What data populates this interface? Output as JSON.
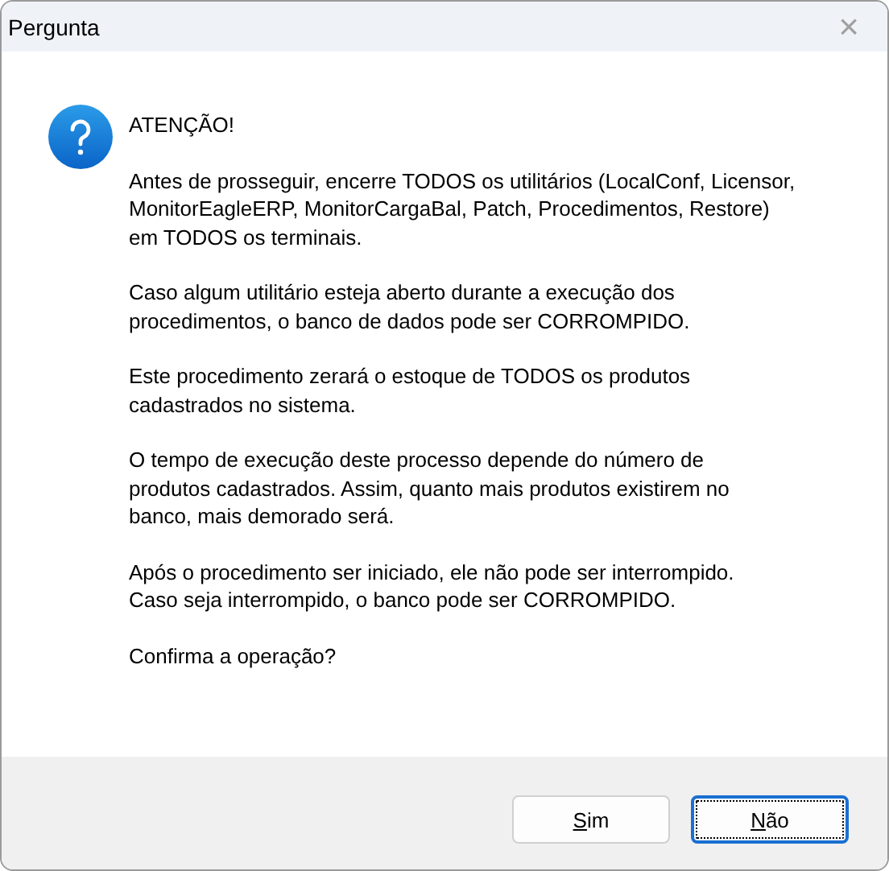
{
  "window": {
    "title": "Pergunta",
    "close": "×"
  },
  "message": {
    "heading": "ATENÇÃO!",
    "paragraphs": [
      "Antes de prosseguir, encerre TODOS os utilitários (LocalConf, Licensor,\nMonitorEagleERP, MonitorCargaBal, Patch, Procedimentos, Restore)\nem TODOS os terminais.",
      "Caso algum utilitário esteja aberto durante a execução dos\nprocedimentos, o banco de dados pode ser CORROMPIDO.",
      "Este procedimento zerará o estoque de TODOS os produtos\ncadastrados no sistema.",
      "O tempo de execução deste processo depende do número de\nprodutos cadastrados. Assim, quanto mais produtos existirem no\nbanco, mais demorado será.",
      "Após o procedimento ser iniciado, ele não pode ser interrompido.\nCaso seja interrompido, o banco pode ser CORROMPIDO.",
      "Confirma a operação?"
    ]
  },
  "buttons": [
    {
      "label": "Sim",
      "selected": false
    },
    {
      "label": "Não",
      "selected": true
    }
  ]
}
